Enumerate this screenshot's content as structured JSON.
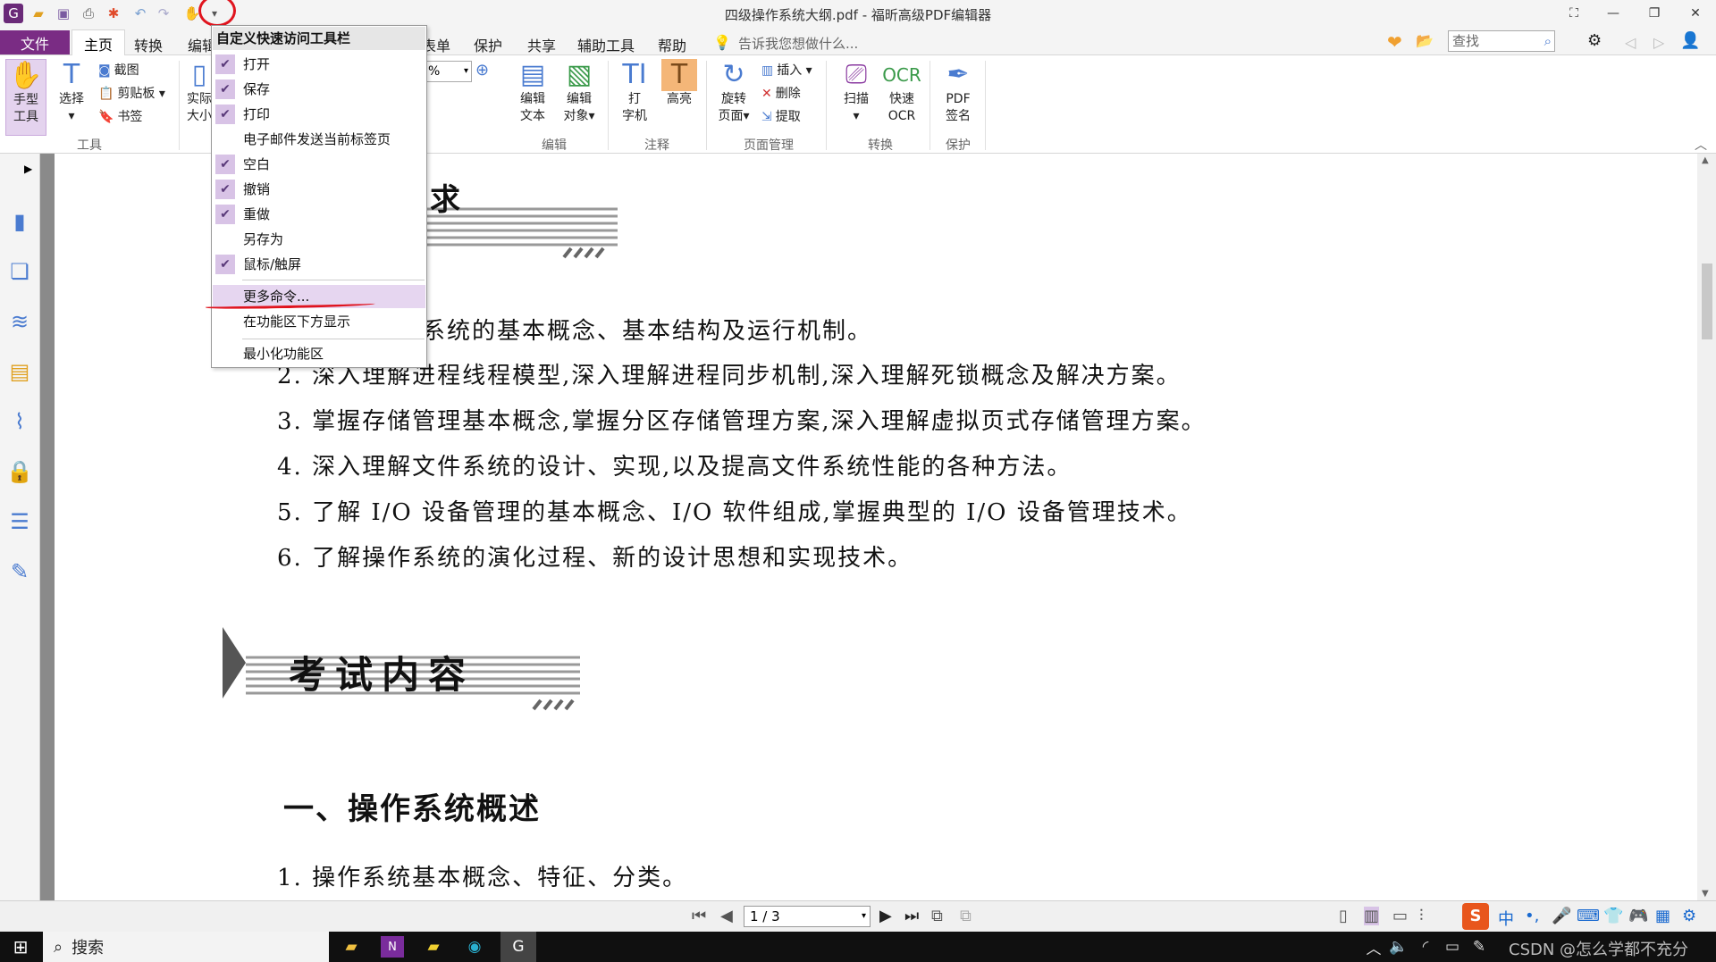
{
  "window": {
    "title": "四级操作系统大纲.pdf - 福昕高级PDF编辑器",
    "qat_icons": [
      "foxit-logo-icon",
      "open-folder-icon",
      "save-icon",
      "print-icon",
      "new-icon",
      "undo-icon",
      "redo-icon",
      "hand-tool-icon",
      "customize-qat-icon"
    ]
  },
  "tabs": {
    "file": "文件",
    "home": "主页",
    "convert": "转换",
    "edit": "编辑",
    "form": "表单",
    "protect": "保护",
    "share": "共享",
    "assist": "辅助工具",
    "help": "帮助",
    "tell_me": "告诉我您想做什么..."
  },
  "search": {
    "placeholder": "查找"
  },
  "ribbon": {
    "hand_tool": "手型\n工具",
    "hand_tool_1": "手型",
    "hand_tool_2": "工具",
    "select": "选择",
    "screenshot": "截图",
    "clipboard": "剪贴板",
    "bookmark": "书签",
    "tools_group": "工具",
    "actual_1": "实际",
    "actual_2": "大小",
    "zoom_value": "%",
    "edit_text_1": "编辑",
    "edit_text_2": "文本",
    "edit_obj_1": "编辑",
    "edit_obj_2": "对象",
    "edit_group": "编辑",
    "typewriter_1": "打",
    "typewriter_2": "字机",
    "highlight": "高亮",
    "annot_group": "注释",
    "rotate_1": "旋转",
    "rotate_2": "页面",
    "insert": "插入",
    "delete": "删除",
    "extract": "提取",
    "page_group": "页面管理",
    "scan": "扫描",
    "ocr_1": "快速",
    "ocr_2": "OCR",
    "convert_group": "转换",
    "sign_1": "PDF",
    "sign_2": "签名",
    "protect_group": "保护"
  },
  "qat_menu": {
    "title": "自定义快速访问工具栏",
    "items": [
      {
        "label": "打开",
        "checked": true
      },
      {
        "label": "保存",
        "checked": true
      },
      {
        "label": "打印",
        "checked": true
      },
      {
        "label": "电子邮件发送当前标签页",
        "checked": false
      },
      {
        "label": "空白",
        "checked": true
      },
      {
        "label": "撤销",
        "checked": true
      },
      {
        "label": "重做",
        "checked": true
      },
      {
        "label": "另存为",
        "checked": false
      },
      {
        "label": "鼠标/触屏",
        "checked": true
      }
    ],
    "more": "更多命令...",
    "show_below": "在功能区下方显示",
    "minimize": "最小化功能区"
  },
  "document": {
    "banner1_char": "求",
    "list": [
      "系统的基本概念、基本结构及运行机制。",
      "2.  深入理解进程线程模型,深入理解进程同步机制,深入理解死锁概念及解决方案。",
      "3.  掌握存储管理基本概念,掌握分区存储管理方案,深入理解虚拟页式存储管理方案。",
      "4.  深入理解文件系统的设计、实现,以及提高文件系统性能的各种方法。",
      "5.  了解 I/O 设备管理的基本概念、I/O 软件组成,掌握典型的 I/O 设备管理技术。",
      "6.  了解操作系统的演化过程、新的设计思想和实现技术。"
    ],
    "banner2": "考试内容",
    "section": "一、操作系统概述",
    "item1": "1.  操作系统基本概念、特征、分类。"
  },
  "status": {
    "page": "1 / 3"
  },
  "taskbar": {
    "search": "搜索",
    "watermark": "CSDN @怎么学都不充分"
  }
}
